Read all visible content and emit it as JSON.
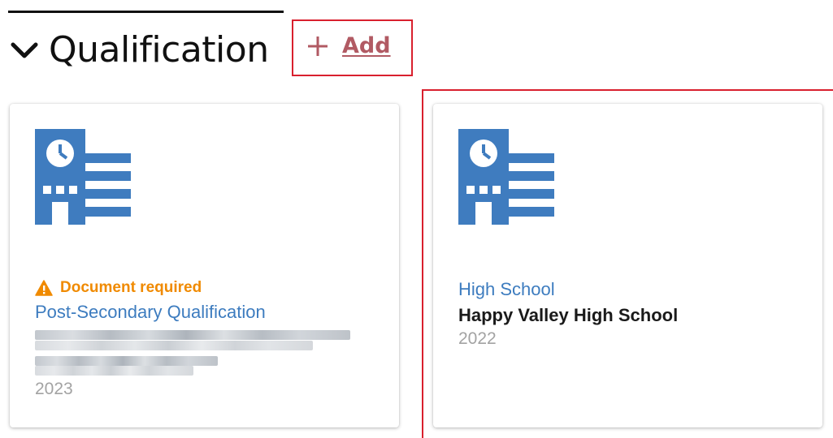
{
  "section": {
    "title": "Qualification",
    "add_label": "Add"
  },
  "colors": {
    "icon_blue": "#3f7cbf",
    "link_blue": "#3d7cbf",
    "warning_orange": "#f08a00",
    "add_link": "#b15a63",
    "highlight_red": "#d9202e"
  },
  "cards": [
    {
      "icon": "school-building-icon",
      "warning": "Document required",
      "type": "Post-Secondary Qualification",
      "institution": "",
      "year": "2023"
    },
    {
      "icon": "school-building-icon",
      "type": "High School",
      "institution": "Happy Valley High School",
      "year": "2022"
    }
  ]
}
